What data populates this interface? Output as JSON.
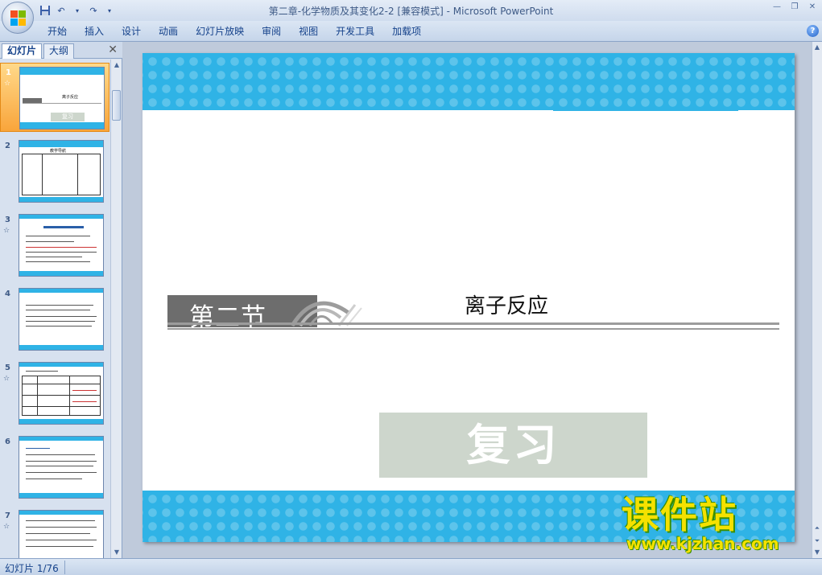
{
  "window": {
    "title": "第二章-化学物质及其变化2-2 [兼容模式]",
    "title_sep": " - ",
    "app_name": "Microsoft PowerPoint"
  },
  "ribbon": {
    "tabs": [
      "开始",
      "插入",
      "设计",
      "动画",
      "幻灯片放映",
      "审阅",
      "视图",
      "开发工具",
      "加载项"
    ]
  },
  "pane": {
    "tab_slides": "幻灯片",
    "tab_outline": "大纲",
    "close_glyph": "✕",
    "thumbnails": [
      {
        "num": "1",
        "star": "☆",
        "selected": true,
        "mini_title": "离子反应",
        "mini_box": "复习"
      },
      {
        "num": "2",
        "star": "",
        "selected": false,
        "mini_title": "教学导航"
      },
      {
        "num": "3",
        "star": "☆",
        "selected": false
      },
      {
        "num": "4",
        "star": "",
        "selected": false
      },
      {
        "num": "5",
        "star": "☆",
        "selected": false
      },
      {
        "num": "6",
        "star": "",
        "selected": false
      },
      {
        "num": "7",
        "star": "☆",
        "selected": false
      }
    ]
  },
  "slide": {
    "section": "第二节",
    "title": "离子反应",
    "review": "复习",
    "colors": {
      "band": "#2fb3e6",
      "section_box": "#6d6d6d",
      "review_box": "#cdd6cc"
    }
  },
  "watermark": {
    "logo": "课件站",
    "url": "www.kjzhan.com"
  },
  "status": {
    "slide_counter": "幻灯片 1/76"
  }
}
